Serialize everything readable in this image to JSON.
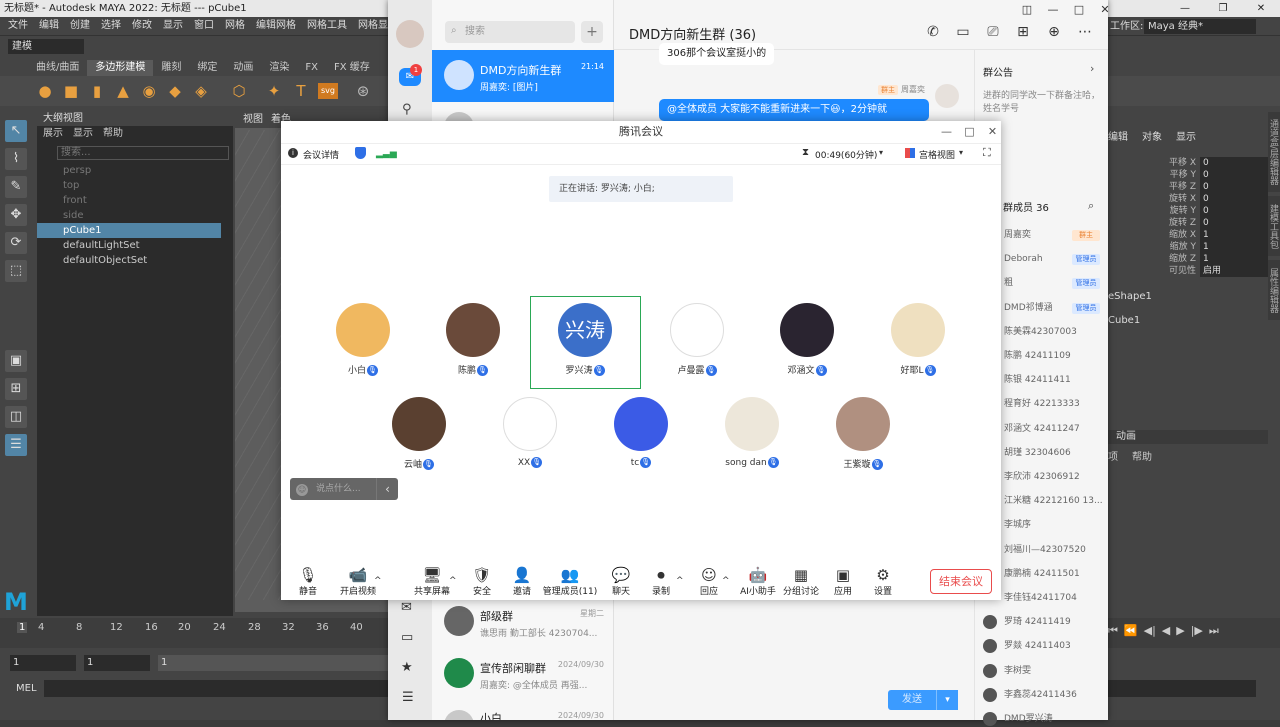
{
  "maya": {
    "title": "无标题* - Autodesk MAYA 2022: 无标题   ---   pCube1",
    "menu": [
      "文件",
      "编辑",
      "创建",
      "选择",
      "修改",
      "显示",
      "窗口",
      "网格",
      "编辑网格",
      "网格工具",
      "网格显示"
    ],
    "mode": "建模",
    "workspace_label": "工作区:",
    "workspace_value": "Maya 经典*",
    "shelf_tabs": [
      "曲线/曲面",
      "多边形建模",
      "雕刻",
      "绑定",
      "动画",
      "渲染",
      "FX",
      "FX 缓存"
    ],
    "shelf_active": "多边形建模",
    "shelf_text_icons": [
      "T",
      "svg"
    ],
    "outliner": {
      "title": "大纲视图",
      "menu": [
        "展示",
        "显示",
        "帮助"
      ],
      "search_placeholder": "搜索...",
      "items": [
        {
          "label": "persp",
          "state": "dim"
        },
        {
          "label": "top",
          "state": "dim"
        },
        {
          "label": "front",
          "state": "dim"
        },
        {
          "label": "side",
          "state": "dim"
        },
        {
          "label": "pCube1",
          "state": "sel"
        },
        {
          "label": "defaultLightSet",
          "state": "normal"
        },
        {
          "label": "defaultObjectSet",
          "state": "normal"
        }
      ]
    },
    "viewport_menu": [
      "视图",
      "着色"
    ],
    "channel_box": {
      "tabs": [
        "编辑",
        "对象",
        "显示"
      ],
      "rows": [
        {
          "label": "平移 X",
          "value": "0"
        },
        {
          "label": "平移 Y",
          "value": "0"
        },
        {
          "label": "平移 Z",
          "value": "0"
        },
        {
          "label": "旋转 X",
          "value": "0"
        },
        {
          "label": "旋转 Y",
          "value": "0"
        },
        {
          "label": "旋转 Z",
          "value": "0"
        },
        {
          "label": "缩放 X",
          "value": "1"
        },
        {
          "label": "缩放 Y",
          "value": "1"
        },
        {
          "label": "缩放 Z",
          "value": "1"
        },
        {
          "label": "可见性",
          "value": "启用"
        }
      ],
      "shape": "eShape1",
      "cube": "Cube1",
      "anim_tab": "动画",
      "anim_menu": [
        "项",
        "帮助"
      ]
    },
    "side_tabs": [
      "通道盒/层编辑器",
      "建模工具包",
      "属性编辑器"
    ],
    "timeline_ticks": [
      "1",
      "4",
      "8",
      "12",
      "16",
      "20",
      "24",
      "28",
      "32",
      "36",
      "40"
    ],
    "frame_start": "1",
    "frame_current": "1",
    "frame_range_start": "1",
    "mel_label": "MEL"
  },
  "chat": {
    "search_placeholder": "搜索",
    "unread_badge": "1",
    "title": "DMD方向新生群 (36)",
    "conversations": [
      {
        "name": "DMD方向新生群",
        "msg": "周嘉奕: [图片]",
        "time": "21:14",
        "active": true
      },
      {
        "name": "部级群",
        "msg": "谯思雨 勤工部长 4230704...",
        "time": "星期二",
        "active": false
      },
      {
        "name": "宣传部闲聊群",
        "msg": "周嘉奕: @全体成员 再强...",
        "time": "2024/09/30",
        "active": false
      },
      {
        "name": "小白",
        "msg": "",
        "time": "2024/09/30",
        "active": false
      }
    ],
    "partial_conv_name": "...",
    "messages": [
      {
        "text": "306那个会议室挺小的",
        "side": "left"
      },
      {
        "sender": "周嘉奕",
        "role": "群主",
        "text": "@全体成员 大家能不能重新进来一下😃，2分钟就",
        "side": "right"
      }
    ],
    "notice_title": "群公告",
    "notice_body": "进群的同学改一下群备注哈，姓名学号",
    "members_title": "群成员 36",
    "members": [
      {
        "name": "周嘉奕",
        "badge": "群主"
      },
      {
        "name": "Deborah",
        "badge": "管理员"
      },
      {
        "name": "粗",
        "badge": "管理员"
      },
      {
        "name": "DMD祁博涵",
        "badge": "管理员"
      },
      {
        "name": "陈美霖42307003",
        "badge": ""
      },
      {
        "name": "陈鹏 42411109",
        "badge": ""
      },
      {
        "name": "陈银 42411411",
        "badge": ""
      },
      {
        "name": "程育好 42213333",
        "badge": ""
      },
      {
        "name": "邓涵文 42411247",
        "badge": ""
      },
      {
        "name": "胡瑾 32304606",
        "badge": ""
      },
      {
        "name": "李欣沛 42306912",
        "badge": ""
      },
      {
        "name": "江米糖 42212160 13...",
        "badge": ""
      },
      {
        "name": "李城序",
        "badge": ""
      },
      {
        "name": "刘福川—42307520",
        "badge": ""
      },
      {
        "name": "康鹏楠 42411501",
        "badge": ""
      },
      {
        "name": "李佳钰42411704",
        "badge": ""
      },
      {
        "name": "罗琦 42411419",
        "badge": ""
      },
      {
        "name": "罗燚 42411403",
        "badge": ""
      },
      {
        "name": "李树雯",
        "badge": ""
      },
      {
        "name": "李鑫蕊42411436",
        "badge": ""
      },
      {
        "name": "DMD罗兴涛",
        "badge": ""
      }
    ],
    "send_label": "发送"
  },
  "meeting": {
    "title": "腾讯会议",
    "info_label": "会议详情",
    "timer": "00:49(60分钟)",
    "layout_label": "宫格视图",
    "speaking": "正在讲话: 罗兴涛; 小白;",
    "active_avatar_text": "兴涛",
    "participants": [
      {
        "name": "小白",
        "color": "#f0b860"
      },
      {
        "name": "陈鹏",
        "color": "#6a4a3a"
      },
      {
        "name": "罗兴涛",
        "color": "#3b6fc9"
      },
      {
        "name": "卢曼露",
        "color": "#ffffff"
      },
      {
        "name": "邓涵文",
        "color": "#2a2430"
      },
      {
        "name": "好耶L",
        "color": "#efe0c0"
      },
      {
        "name": "云岫",
        "color": "#5a4030"
      },
      {
        "name": "XX",
        "color": "#ffffff"
      },
      {
        "name": "tc",
        "color": "#3b5be6"
      },
      {
        "name": "song dan",
        "color": "#ede7da"
      },
      {
        "name": "王紫璇",
        "color": "#b09080"
      }
    ],
    "say_placeholder": "说点什么...",
    "tools": [
      {
        "label": "静音",
        "icon": "🎙"
      },
      {
        "label": "开启视频",
        "icon": "📹"
      },
      {
        "label": "共享屏幕",
        "icon": "🖥"
      },
      {
        "label": "安全",
        "icon": "🛡"
      },
      {
        "label": "邀请",
        "icon": "👤"
      },
      {
        "label": "管理成员(11)",
        "icon": "👥"
      },
      {
        "label": "聊天",
        "icon": "💬"
      },
      {
        "label": "录制",
        "icon": "⏺"
      },
      {
        "label": "回应",
        "icon": "☺"
      },
      {
        "label": "AI小助手",
        "icon": "🤖"
      },
      {
        "label": "分组讨论",
        "icon": "▦"
      },
      {
        "label": "应用",
        "icon": "▣"
      },
      {
        "label": "设置",
        "icon": "⚙"
      }
    ],
    "end_label": "结束会议"
  }
}
